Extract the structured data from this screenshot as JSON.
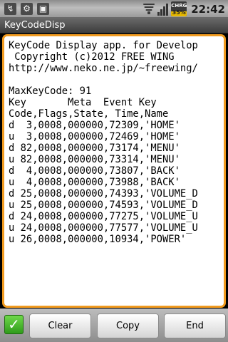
{
  "status_bar": {
    "icons": [
      "usb-icon",
      "usb-debugging-icon",
      "android-icon"
    ],
    "battery_text_top": "CHRG",
    "battery_text_bottom": "35%",
    "battery_level": 0.35,
    "time": "22:42"
  },
  "title_bar": {
    "title": "KeyCodeDisp"
  },
  "log_text": "KeyCode Display app. for Develop\n Copyright (c)2012 FREE WING\nhttp://www.neko.ne.jp/~freewing/\n\nMaxKeyCode: 91\nKey       Meta  Event Key\nCode,Flags,State, Time,Name\nd  3,0008,000000,72309,'HOME'\nu  3,0008,000000,72469,'HOME'\nd 82,0008,000000,73174,'MENU'\nu 82,0008,000000,73314,'MENU'\nd  4,0008,000000,73807,'BACK'\nu  4,0008,000000,73988,'BACK'\nd 25,0008,000000,74393,'VOLUME_D\nu 25,0008,000000,74593,'VOLUME_D\nd 24,0008,000000,77275,'VOLUME_U\nu 24,0008,000000,77577,'VOLUME_U\nu 26,0008,000000,10934,'POWER'",
  "buttons": {
    "clear": "Clear",
    "copy": "Copy",
    "end": "End"
  },
  "colors": {
    "panel_border": "#f09a1f",
    "check_green": "#2f9b1b"
  }
}
